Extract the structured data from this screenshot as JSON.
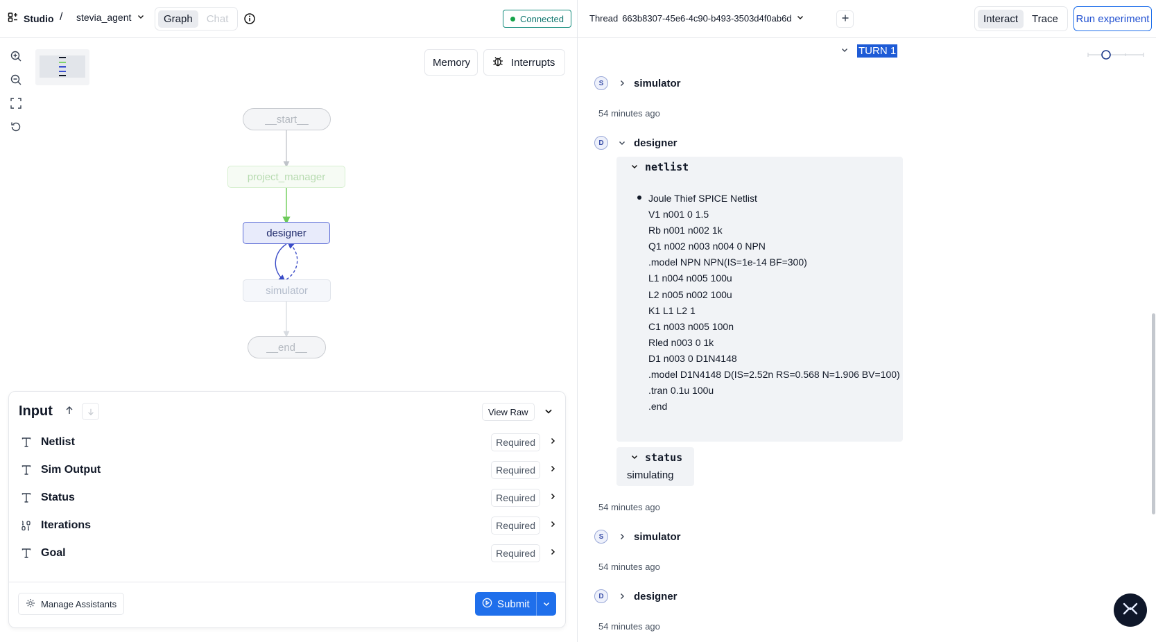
{
  "header": {
    "studio_label": "Studio",
    "breadcrumb_sep": "/",
    "assistant_name": "stevia_agent",
    "tabs": [
      {
        "label": "Graph"
      },
      {
        "label": "Chat"
      }
    ],
    "connection_status": "Connected"
  },
  "graph": {
    "memory_label": "Memory",
    "interrupts_label": "Interrupts",
    "nodes": [
      {
        "label": "__start__"
      },
      {
        "label": "project_manager"
      },
      {
        "label": "designer"
      },
      {
        "label": "simulator"
      },
      {
        "label": "__end__"
      }
    ]
  },
  "input": {
    "title": "Input",
    "view_raw_label": "View Raw",
    "fields": [
      {
        "label": "Netlist",
        "badge": "Required",
        "icon": "text-type-icon"
      },
      {
        "label": "Sim Output",
        "badge": "Required",
        "icon": "text-type-icon"
      },
      {
        "label": "Status",
        "badge": "Required",
        "icon": "text-type-icon"
      },
      {
        "label": "Iterations",
        "badge": "Required",
        "icon": "number-type-icon"
      },
      {
        "label": "Goal",
        "badge": "Required",
        "icon": "text-type-icon"
      }
    ],
    "manage_label": "Manage Assistants",
    "submit_label": "Submit"
  },
  "thread": {
    "label": "Thread",
    "id": "663b8307-45e6-4c90-b493-3503d4f0ab6d",
    "modes": [
      {
        "label": "Interact"
      },
      {
        "label": "Trace"
      }
    ],
    "run_label": "Run experiment",
    "turn_label": "TURN 1",
    "events": [
      {
        "avatar": "S",
        "name": "simulator",
        "ago": "54 minutes ago"
      },
      {
        "avatar": "D",
        "name": "designer",
        "ago": "54 minutes ago"
      },
      {
        "avatar": "S",
        "name": "simulator",
        "ago": "54 minutes ago"
      },
      {
        "avatar": "D",
        "name": "designer",
        "ago": "54 minutes ago"
      }
    ],
    "netlist_key": "netlist",
    "netlist_lines": [
      "Joule Thief SPICE Netlist",
      "V1 n001 0 1.5",
      "Rb n001 n002 1k",
      "Q1 n002 n003 n004 0 NPN",
      ".model NPN NPN(IS=1e-14 BF=300)",
      "L1 n004 n005 100u",
      "L2 n005 n002 100u",
      "K1 L1 L2 1",
      "C1 n003 n005 100n",
      "Rled n003 0 1k",
      "D1 n003 0 D1N4148",
      ".model D1N4148 D(IS=2.52n RS=0.568 N=1.906 BV=100)",
      ".tran 0.1u 100u",
      ".end"
    ],
    "status_key": "status",
    "status_value": "simulating"
  },
  "colors": {
    "accent": "#1f6feb",
    "connected": "#0f766e",
    "designer_node_bg": "#e8ebfb",
    "designer_node_border": "#5b6bd6",
    "green_edge": "#7fd36b"
  }
}
